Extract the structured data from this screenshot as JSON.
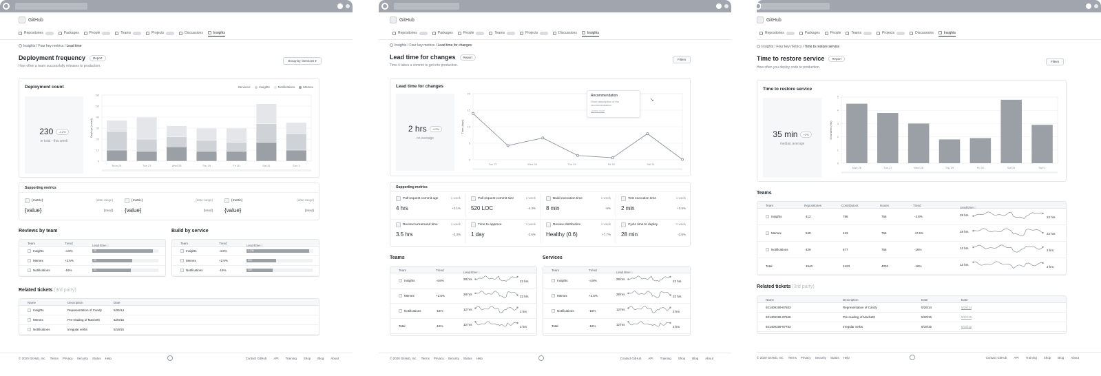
{
  "brand": "GitHub",
  "nav": [
    "Repositories",
    "Packages",
    "People",
    "Teams",
    "Projects",
    "Discussions",
    "Insights"
  ],
  "footer": {
    "copyright": "© 2020 GitHub, Inc.",
    "left": [
      "Terms",
      "Privacy",
      "Security",
      "Status",
      "Help"
    ],
    "right": [
      "Contact GitHub",
      "API",
      "Training",
      "Shop",
      "Blog",
      "About"
    ]
  },
  "colors": {
    "bar_light": "#e4e6ea",
    "bar_mid": "#cfd3d8",
    "bar_dark": "#9aa0a6",
    "line": "#8a9099"
  },
  "w1": {
    "crumb": [
      "Insights",
      "Four key metrics",
      "Lead time"
    ],
    "title": "Deployment frequency",
    "tag": "Report",
    "desc": "How often a team successfully releases to production.",
    "group_by": "Group by: Services",
    "card_title": "Deployment count",
    "legend_label": "Services:",
    "big_value": "230",
    "big_chip": "-4.2%",
    "big_sub": "in total - this week",
    "supporting_title": "Supporting metrics",
    "metric": {
      "label": "{metric}",
      "range": "{date-range}",
      "value": "{value}",
      "trend": "{trend}"
    },
    "reviews_title": "Reviews by team",
    "reviews_headers": [
      "Team",
      "Trend",
      "Lead time"
    ],
    "reviews_headers_extra": "(Avg / Total)",
    "reviews_rows": [
      {
        "team": "Insights",
        "trend": "-4.8%",
        "bar": "38",
        "fill": 0.92
      },
      {
        "team": "Memex",
        "trend": "+2.5%",
        "bar": "22",
        "fill": 0.6
      },
      {
        "team": "Notifications",
        "trend": "-16%",
        "bar": "21",
        "fill": 0.58
      }
    ],
    "build_title": "Build by service",
    "build_headers": [
      "Team",
      "Trend",
      "Lead time"
    ],
    "build_headers_extra": "(Avg / Total)",
    "build_rows": [
      {
        "team": "Insights",
        "trend": "-4.8%",
        "bar": "1,234",
        "fill": 0.95
      },
      {
        "team": "Memex",
        "trend": "+2.5%",
        "bar": "600",
        "fill": 0.45
      },
      {
        "team": "Notifications",
        "trend": "-16%",
        "bar": "320",
        "fill": 0.4
      }
    ],
    "tickets_title": "Related tickets",
    "tickets_extra": "(3rd party)",
    "tickets_headers": [
      "Name",
      "Description",
      "Date"
    ],
    "tickets_rows": [
      [
        "Insights",
        "Representation of Candy",
        "5/26/14"
      ],
      [
        "Memex",
        "Pre-reading of Macbeth",
        "5/20/15"
      ],
      [
        "Notifications",
        "Irregular verbs",
        "5/18/15"
      ]
    ]
  },
  "w2": {
    "crumb": [
      "Insights",
      "Four key metrics",
      "Lead time for changes"
    ],
    "title": "Lead time for changes",
    "tag": "Report",
    "desc": "Time it takes a commit to get into production.",
    "filters": "Filters",
    "card_title": "Lead time for changes",
    "big_value": "2 hrs",
    "big_chip": "-4.2%",
    "big_sub": "on average",
    "tooltip": {
      "title": "Recommendation",
      "body": "Short description of the recommendation.",
      "link": "Learn more"
    },
    "supporting_title": "Supporting metrics",
    "metrics": [
      {
        "label": "Pull request commit age",
        "period": "1 week",
        "value": "4 hrs",
        "change": "+2.1%"
      },
      {
        "label": "Pull request commit size",
        "period": "1 week",
        "value": "520 LOC",
        "change": "-4.3%"
      },
      {
        "label": "Build execution time",
        "period": "1 week",
        "value": "8 min",
        "change": "-6%"
      },
      {
        "label": "Test execution time",
        "period": "1 week",
        "value": "2 min",
        "change": "+3.5%"
      },
      {
        "label": "Review turnaround time",
        "period": "1 week",
        "value": "3.5 hrs",
        "change": "-2.3%"
      },
      {
        "label": "Time to approve",
        "period": "1 week",
        "value": "1 day",
        "change": "-2.6%"
      },
      {
        "label": "Review distribution",
        "period": "1 week",
        "value": "Healthy (0.6)",
        "change": "+7.7%"
      },
      {
        "label": "Cycle time to deploy",
        "period": "1 week",
        "value": "28 min",
        "change": "-2.6%"
      }
    ],
    "teams_title": "Teams",
    "services_title": "Services",
    "tbl_headers": [
      "Team",
      "Trend",
      "Lead time"
    ],
    "tbl_headers_extra": "(Avg / Total)",
    "teams_rows": [
      {
        "team": "Insights",
        "trend": "-4.8%",
        "a": "28 hrs",
        "b": "22 hrs"
      },
      {
        "team": "Memex",
        "trend": "+2.5%",
        "a": "28 hrs",
        "b": "22 hrs"
      },
      {
        "team": "Notifications",
        "trend": "-16%",
        "a": "12 hrs",
        "b": "2 hrs"
      },
      {
        "team": "Total",
        "trend": "-16%",
        "a": "12 hrs",
        "b": "2 hrs"
      }
    ],
    "services_rows": [
      {
        "team": "Insights",
        "trend": "-4.8%",
        "a": "28 hrs",
        "b": "22 hrs"
      },
      {
        "team": "Memex",
        "trend": "+2.5%",
        "a": "28 hrs",
        "b": "22 hrs"
      },
      {
        "team": "Notifications",
        "trend": "-16%",
        "a": "12 hrs",
        "b": "2 hrs"
      },
      {
        "team": "Total",
        "trend": "-16%",
        "a": "12 hrs",
        "b": "2 hrs"
      }
    ]
  },
  "w3": {
    "crumb": [
      "Insights",
      "Four key metrics",
      "Time to restore service"
    ],
    "title": "Time to restore service",
    "tag": "Report",
    "desc": "How often you deploy code to production.",
    "filters": "Filters",
    "card_title": "Time to restore service",
    "big_value": "35 min",
    "big_chip": "+2%",
    "big_sub": "median average",
    "teams_title": "Teams",
    "teams_headers": [
      "Team",
      "Repositories",
      "Contributors",
      "Issues",
      "Trend",
      "Lead time"
    ],
    "teams_headers_extra": "(Avg / Total)",
    "teams_rows": [
      {
        "team": "Insights",
        "repos": "412",
        "contrib": "786",
        "issues": "756",
        "trend": "-4.8%",
        "a": "28 hrs",
        "b": "22 hrs"
      },
      {
        "team": "Memex",
        "repos": "540",
        "contrib": "423",
        "issues": "756",
        "trend": "+2.5%",
        "a": "28 hrs",
        "b": "22 hrs"
      },
      {
        "team": "Notifications",
        "repos": "429",
        "contrib": "677",
        "issues": "756",
        "trend": "-16%",
        "a": "12 hrs",
        "b": "2 hrs"
      },
      {
        "team": "Total",
        "repos": "1540",
        "contrib": "2423",
        "issues": "4002",
        "trend": "-16%",
        "a": "12 hrs",
        "b": "2 hrs"
      }
    ],
    "tickets_title": "Related tickets",
    "tickets_extra": "(3rd party)",
    "tickets_headers": [
      "Name",
      "Description",
      "Date",
      "Date"
    ],
    "tickets_rows": [
      [
        "921409199-87683",
        "Representation of Candy",
        "5/26/14",
        "5/26/14"
      ],
      [
        "921409199-87666",
        "Pre-reading of Macbeth",
        "5/20/15",
        "5/20/15"
      ],
      [
        "921409199-87783",
        "Irregular verbs",
        "6/16/15",
        "6/16/15"
      ]
    ]
  },
  "chart_data": [
    {
      "type": "bar",
      "title": "Deployment count",
      "ylabel": "Deploys (count)",
      "categories": [
        "Mon 25",
        "Tue 27",
        "Wed 28",
        "Thu 29",
        "Fri 30",
        "Sat 31",
        "Sun 1"
      ],
      "ylim": [
        0,
        60
      ],
      "yticks": [
        0,
        10,
        20,
        30,
        40,
        50,
        60
      ],
      "stacked": true,
      "legend": "top-right",
      "series": [
        {
          "name": "Memex",
          "values": [
            10,
            9,
            13,
            9,
            9,
            17,
            10
          ]
        },
        {
          "name": "Notifications",
          "values": [
            17,
            11,
            9,
            10,
            8,
            17,
            15
          ]
        },
        {
          "name": "Insights",
          "values": [
            10,
            20,
            10,
            11,
            13,
            18,
            10
          ]
        }
      ]
    },
    {
      "type": "line",
      "title": "Lead time for changes",
      "ylabel": "Time (days)",
      "categories": [
        "Tue 27",
        "Wed 28",
        "Thu 29",
        "Fri 30",
        "Sat 31"
      ],
      "x": [
        0,
        1,
        2,
        3,
        4,
        5,
        6,
        7
      ],
      "ylim": [
        0,
        20
      ],
      "yticks": [
        0,
        5,
        10,
        15,
        20
      ],
      "values": [
        14,
        4.3,
        6.6,
        1.3,
        0.6,
        7.9,
        0.1
      ]
    },
    {
      "type": "bar",
      "title": "Time to restore service",
      "ylabel": "Downtime (hrs)",
      "categories": [
        "Mon 26",
        "Tue 27",
        "Wed 28",
        "Thu 29",
        "Fri 30",
        "Sat 31",
        "Sun 1"
      ],
      "ylim": [
        0,
        5
      ],
      "yticks": [
        0,
        1,
        2,
        3,
        4,
        5
      ],
      "values": [
        4.5,
        3.8,
        3.0,
        1.8,
        1.9,
        4.8,
        2.9
      ]
    }
  ]
}
